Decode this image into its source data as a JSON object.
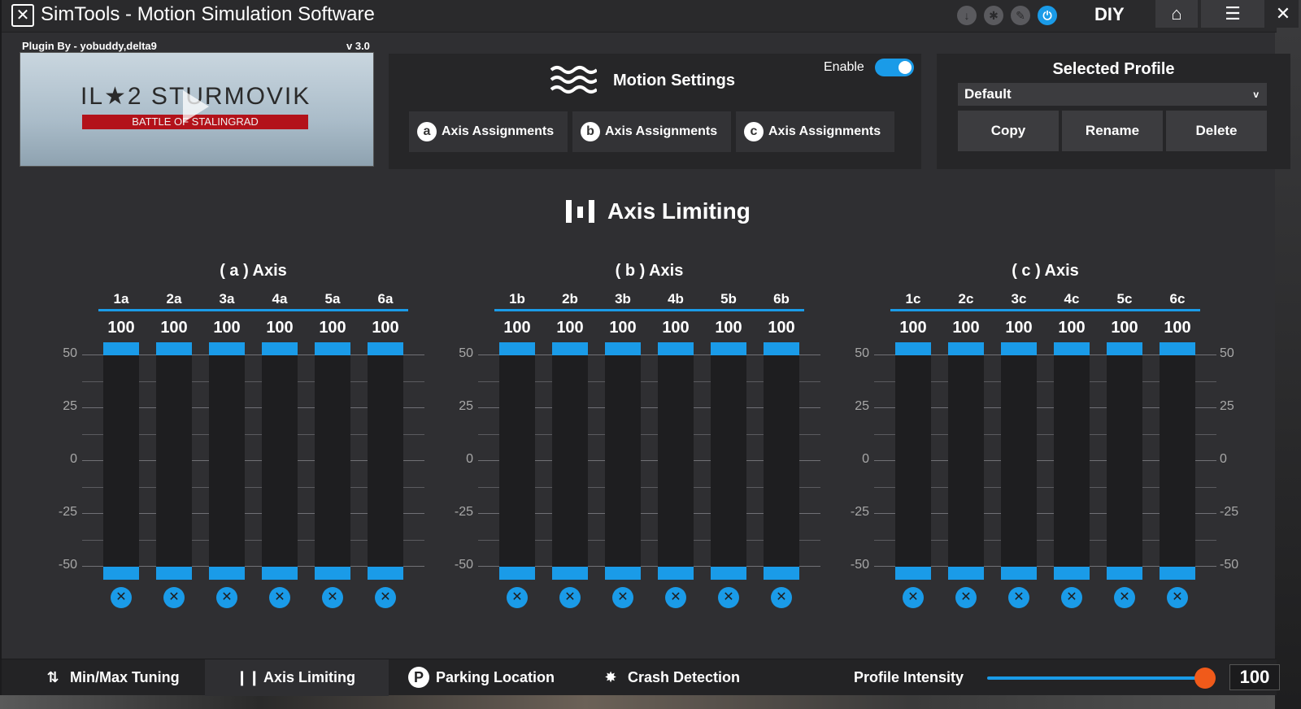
{
  "window": {
    "title": "SimTools - Motion Simulation Software",
    "diy_label": "DIY"
  },
  "plugin": {
    "by": "Plugin By - yobuddy,delta9",
    "version": "v 3.0",
    "game_title": "IL★2 STURMOVIK",
    "game_subtitle": "BATTLE OF STALINGRAD"
  },
  "motion": {
    "title": "Motion Settings",
    "enable_label": "Enable",
    "enabled": true,
    "assignments": [
      {
        "badge": "a",
        "label": "Axis Assignments"
      },
      {
        "badge": "b",
        "label": "Axis Assignments"
      },
      {
        "badge": "c",
        "label": "Axis Assignments"
      }
    ]
  },
  "profile": {
    "title": "Selected Profile",
    "selected": "Default",
    "caret": "v",
    "copy": "Copy",
    "rename": "Rename",
    "delete": "Delete"
  },
  "axis_limiting": {
    "title": "Axis Limiting",
    "scale": [
      "50",
      "25",
      "0",
      "-25",
      "-50"
    ],
    "groups": [
      {
        "title": "( a ) Axis",
        "channels": [
          {
            "label": "1a",
            "value": "100"
          },
          {
            "label": "2a",
            "value": "100"
          },
          {
            "label": "3a",
            "value": "100"
          },
          {
            "label": "4a",
            "value": "100"
          },
          {
            "label": "5a",
            "value": "100"
          },
          {
            "label": "6a",
            "value": "100"
          }
        ]
      },
      {
        "title": "( b ) Axis",
        "channels": [
          {
            "label": "1b",
            "value": "100"
          },
          {
            "label": "2b",
            "value": "100"
          },
          {
            "label": "3b",
            "value": "100"
          },
          {
            "label": "4b",
            "value": "100"
          },
          {
            "label": "5b",
            "value": "100"
          },
          {
            "label": "6b",
            "value": "100"
          }
        ]
      },
      {
        "title": "( c ) Axis",
        "channels": [
          {
            "label": "1c",
            "value": "100"
          },
          {
            "label": "2c",
            "value": "100"
          },
          {
            "label": "3c",
            "value": "100"
          },
          {
            "label": "4c",
            "value": "100"
          },
          {
            "label": "5c",
            "value": "100"
          },
          {
            "label": "6c",
            "value": "100"
          }
        ]
      }
    ]
  },
  "bottom": {
    "tabs": [
      {
        "label": "Min/Max Tuning",
        "icon": "arrows-updown-icon"
      },
      {
        "label": "Axis Limiting",
        "icon": "bars-icon"
      },
      {
        "label": "Parking Location",
        "icon": "parking-icon"
      },
      {
        "label": "Crash Detection",
        "icon": "crash-icon"
      }
    ],
    "intensity_label": "Profile Intensity",
    "intensity_value": "100",
    "intensity_fraction": 1.0
  },
  "colors": {
    "accent": "#1a9be8",
    "knob": "#f05a1a",
    "background": "#2f2f32"
  }
}
